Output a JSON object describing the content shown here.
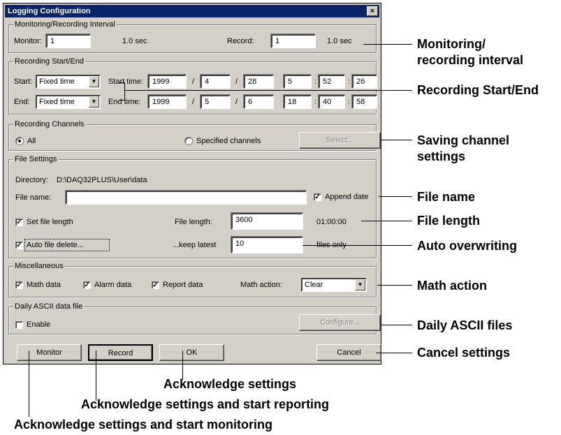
{
  "window": {
    "title": "Logging Configuration",
    "close_glyph": "×"
  },
  "interval": {
    "group_label": "Monitoring/Recording Interval",
    "monitor_label": "Monitor:",
    "monitor_value": "1",
    "monitor_text": "1.0 sec",
    "record_label": "Record:",
    "record_value": "1",
    "record_text": "1.0 sec"
  },
  "startend": {
    "group_label": "Recording Start/End",
    "start_label": "Start:",
    "start_mode": "Fixed time",
    "start_time_label": "Start time:",
    "start_year": "1999",
    "start_month": "4",
    "start_day": "28",
    "start_hour": "5",
    "start_min": "52",
    "start_sec": "26",
    "end_label": "End:",
    "end_mode": "Fixed time",
    "end_time_label": "End time:",
    "end_year": "1999",
    "end_month": "5",
    "end_day": "6",
    "end_hour": "18",
    "end_min": "40",
    "end_sec": "58",
    "date_sep": "/",
    "time_sep": ":"
  },
  "channels": {
    "group_label": "Recording Channels",
    "all_label": "All",
    "specified_label": "Specified channels",
    "select_button": "Select..."
  },
  "file": {
    "group_label": "File Settings",
    "directory_label": "Directory:",
    "directory_value": "D:\\DAQ32PLUS\\User\\data",
    "filename_label": "File name:",
    "filename_value": "",
    "append_date_label": "Append date",
    "set_length_label": "Set file length",
    "file_length_label": "File length:",
    "file_length_value": "3600",
    "file_length_time": "01:00:00",
    "auto_delete_label": "Auto file delete...",
    "keep_latest_label": "...keep latest",
    "keep_latest_value": "10",
    "files_only_label": "files only"
  },
  "misc": {
    "group_label": "Miscellaneous",
    "math_data_label": "Math data",
    "alarm_data_label": "Alarm data",
    "report_data_label": "Report data",
    "math_action_label": "Math action:",
    "math_action_value": "Clear"
  },
  "daily": {
    "group_label": "Daily ASCII data file",
    "enable_label": "Enable",
    "configure_button": "Configure..."
  },
  "buttons": {
    "monitor": "Monitor",
    "record": "Record",
    "ok": "OK",
    "cancel": "Cancel"
  },
  "icons": {
    "check": "✓",
    "dropdown_arrow": "▼"
  },
  "annotations": {
    "interval_1": "Monitoring/",
    "interval_2": "recording interval",
    "startend": "Recording Start/End",
    "channels_1": "Saving channel",
    "channels_2": "settings",
    "file_name": "File name",
    "file_length": "File length",
    "auto_overwrite": "Auto overwriting",
    "math_action": "Math action",
    "daily_ascii": "Daily ASCII files",
    "cancel": "Cancel settings",
    "ok": "Acknowledge settings",
    "record": "Acknowledge settings and start reporting",
    "monitor": "Acknowledge settings and start monitoring"
  }
}
